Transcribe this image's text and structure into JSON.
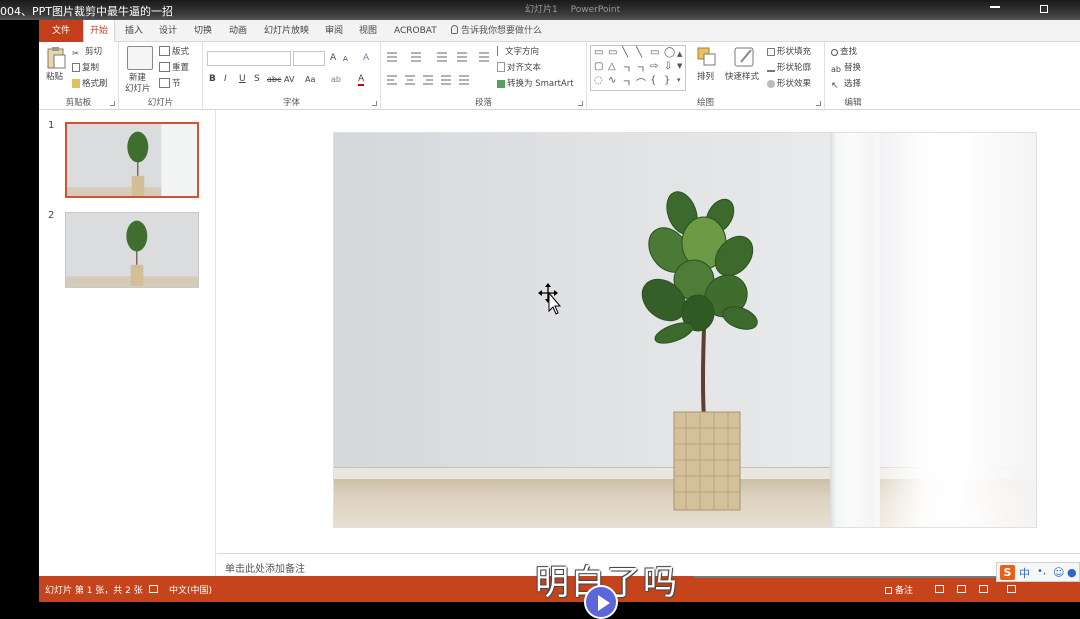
{
  "video_title": "004、PPT图片裁剪中最牛逼的一招",
  "window_titlebar": [
    "幻灯片1",
    "PowerPoint"
  ],
  "tabs": {
    "file": "文件",
    "items": [
      "开始",
      "插入",
      "设计",
      "切换",
      "动画",
      "幻灯片放映",
      "审阅",
      "视图",
      "ACROBAT"
    ],
    "active": "开始",
    "tell_me": "告诉我你想要做什么"
  },
  "ribbon": {
    "clipboard": {
      "label": "剪贴板",
      "paste": "粘贴",
      "cut": "剪切",
      "copy": "复制",
      "format_painter": "格式刷"
    },
    "slides": {
      "label": "幻灯片",
      "new_slide_line1": "新建",
      "new_slide_line2": "幻灯片",
      "layout": "版式",
      "reset": "重置",
      "section": "节"
    },
    "font": {
      "label": "字体",
      "bold": "B",
      "italic": "I",
      "underline": "U",
      "shadow": "S",
      "strike": "abc",
      "spacing": "AV",
      "case": "Aa",
      "grow": "A",
      "shrink": "A",
      "clear": "A",
      "color": "A"
    },
    "paragraph": {
      "label": "段落",
      "text_direction": "文字方向",
      "align_text": "对齐文本",
      "smartart": "转换为 SmartArt"
    },
    "drawing": {
      "label": "绘图",
      "arrange": "排列",
      "quick_styles": "快速样式",
      "shape_fill": "形状填充",
      "shape_outline": "形状轮廓",
      "shape_effects": "形状效果"
    },
    "editing": {
      "label": "编辑",
      "find": "查找",
      "replace": "替换",
      "select": "选择"
    }
  },
  "thumbnails": [
    {
      "number": "1",
      "selected": true
    },
    {
      "number": "2",
      "selected": false
    }
  ],
  "notes_placeholder": "单击此处添加备注",
  "status": {
    "slide_info": "幻灯片 第 1 张，共 2 张",
    "language": "中文(中国)",
    "notes": "备注"
  },
  "subtitle": "明白了吗",
  "ime": {
    "logo": "S",
    "mode": "中"
  },
  "colors": {
    "accent": "#c43e1c",
    "status_bar": "#c5441b",
    "selected_thumb": "#d35230"
  }
}
